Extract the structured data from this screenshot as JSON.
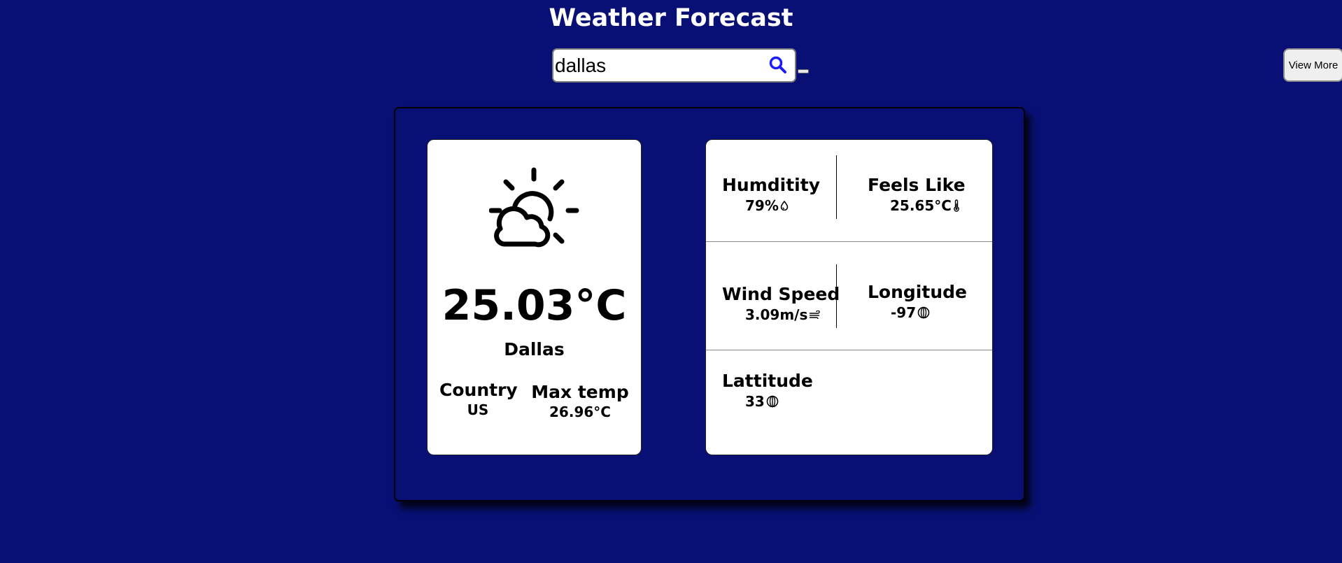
{
  "header": {
    "title": "Weather Forecast"
  },
  "search": {
    "value": "dallas",
    "icon": "search-icon"
  },
  "view_more": {
    "label": "View More"
  },
  "main_card": {
    "icon": "partly-cloudy-icon",
    "temperature": "25.03°C",
    "city": "Dallas",
    "country_label": "Country",
    "country_value": "US",
    "max_temp_label": "Max temp",
    "max_temp_value": "26.96°C"
  },
  "details": {
    "humidity": {
      "label": "Humditity",
      "value": "79%",
      "icon": "water-drop-icon"
    },
    "feels_like": {
      "label": "Feels Like",
      "value": "25.65°C",
      "icon": "thermometer-icon"
    },
    "wind_speed": {
      "label": "Wind Speed",
      "value": "3.09m/s",
      "icon": "wind-icon"
    },
    "longitude": {
      "label": "Longitude",
      "value": "-97",
      "icon": "globe-icon"
    },
    "latitude": {
      "label": "Lattitude",
      "value": "33",
      "icon": "globe-icon"
    }
  },
  "colors": {
    "background": "#081075",
    "search_icon": "#1a1aff",
    "card": "#ffffff"
  }
}
